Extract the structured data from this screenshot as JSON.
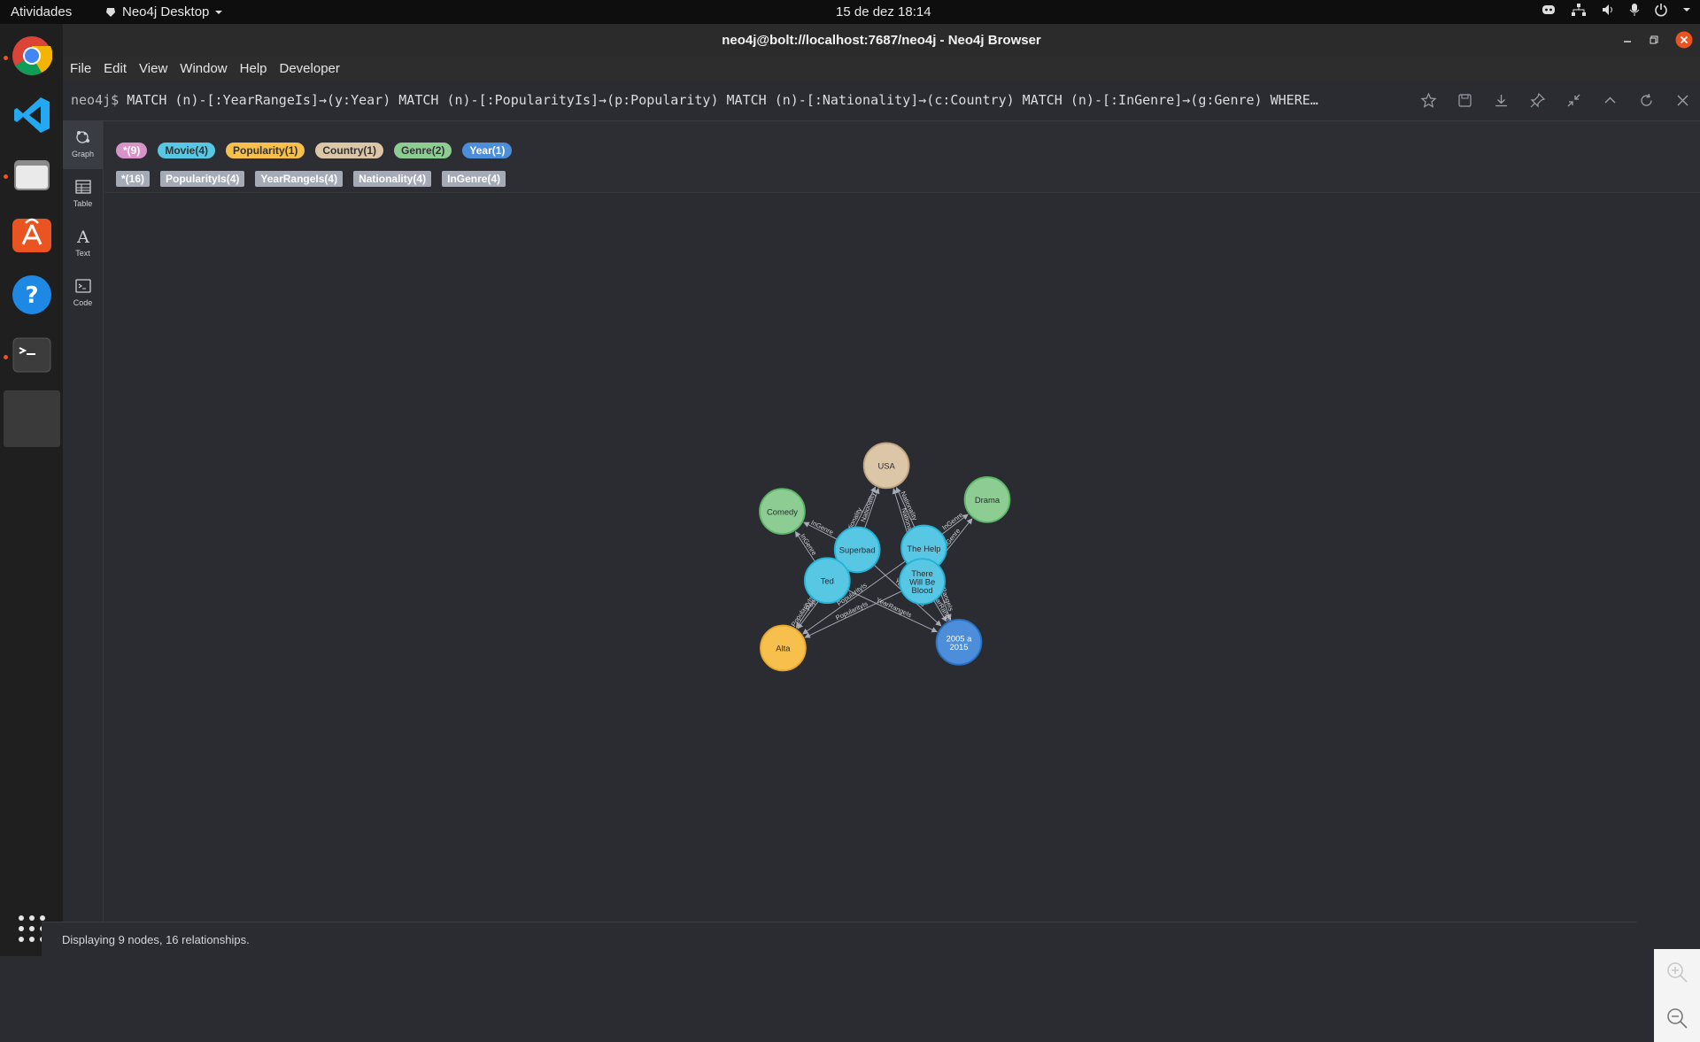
{
  "topbar": {
    "activities": "Atividades",
    "app_name": "Neo4j Desktop",
    "clock": "15 de dez  18:14"
  },
  "window": {
    "title": "neo4j@bolt://localhost:7687/neo4j - Neo4j Browser"
  },
  "menu": [
    "File",
    "Edit",
    "View",
    "Window",
    "Help",
    "Developer"
  ],
  "query": {
    "prompt": "neo4j$",
    "text": "MATCH (n)-[:YearRangeIs]→(y:Year) MATCH (n)-[:PopularityIs]→(p:Popularity) MATCH (n)-[:Nationality]→(c:Country) MATCH (n)-[:InGenre]→(g:Genre) WHERE…"
  },
  "rail": [
    {
      "label": "Graph",
      "icon": "graph-icon"
    },
    {
      "label": "Table",
      "icon": "table-icon"
    },
    {
      "label": "Text",
      "icon": "text-icon"
    },
    {
      "label": "Code",
      "icon": "code-icon"
    }
  ],
  "node_labels": [
    {
      "text": "*(9)",
      "color": "#d893c9"
    },
    {
      "text": "Movie(4)",
      "color": "#57c7e3"
    },
    {
      "text": "Popularity(1)",
      "color": "#f7c04c"
    },
    {
      "text": "Country(1)",
      "color": "#dcc6a8"
    },
    {
      "text": "Genre(2)",
      "color": "#8dcc93"
    },
    {
      "text": "Year(1)",
      "color": "#4c8eda"
    }
  ],
  "rel_types": [
    "*(16)",
    "PopularityIs(4)",
    "YearRangeIs(4)",
    "Nationality(4)",
    "InGenre(4)"
  ],
  "graph": {
    "nodes": [
      {
        "id": "usa",
        "label": "USA",
        "color": "#dcc6a8",
        "border": "#c0a47f"
      },
      {
        "id": "comedy",
        "label": "Comedy",
        "color": "#8dcc93",
        "border": "#5db665"
      },
      {
        "id": "drama",
        "label": "Drama",
        "color": "#8dcc93",
        "border": "#5db665"
      },
      {
        "id": "superbad",
        "label": "Superbad",
        "color": "#57c7e3",
        "border": "#23b3d7"
      },
      {
        "id": "thehelp",
        "label": "The Help",
        "color": "#57c7e3",
        "border": "#23b3d7"
      },
      {
        "id": "ted",
        "label": "Ted",
        "color": "#57c7e3",
        "border": "#23b3d7"
      },
      {
        "id": "twbb",
        "label": "There Will Be Blood",
        "color": "#57c7e3",
        "border": "#23b3d7"
      },
      {
        "id": "alta",
        "label": "Alta",
        "color": "#f7c04c",
        "border": "#e7a82e"
      },
      {
        "id": "year",
        "label": "2005 a 2015",
        "color": "#4c8eda",
        "border": "#2870c2"
      }
    ],
    "relationships": [
      {
        "from": "superbad",
        "to": "usa",
        "type": "Nationality"
      },
      {
        "from": "ted",
        "to": "usa",
        "type": "Nationality"
      },
      {
        "from": "thehelp",
        "to": "usa",
        "type": "Nationality"
      },
      {
        "from": "twbb",
        "to": "usa",
        "type": "Nationality"
      },
      {
        "from": "superbad",
        "to": "comedy",
        "type": "InGenre"
      },
      {
        "from": "ted",
        "to": "comedy",
        "type": "InGenre"
      },
      {
        "from": "thehelp",
        "to": "drama",
        "type": "InGenre"
      },
      {
        "from": "twbb",
        "to": "drama",
        "type": "InGenre"
      },
      {
        "from": "superbad",
        "to": "alta",
        "type": "PopularityIs"
      },
      {
        "from": "ted",
        "to": "alta",
        "type": "PopularityIs"
      },
      {
        "from": "thehelp",
        "to": "alta",
        "type": "PopularityIs"
      },
      {
        "from": "twbb",
        "to": "alta",
        "type": "PopularityIs"
      },
      {
        "from": "superbad",
        "to": "year",
        "type": "YearRangeIs"
      },
      {
        "from": "ted",
        "to": "year",
        "type": "YearRangeIs"
      },
      {
        "from": "thehelp",
        "to": "year",
        "type": "YearRangeIs"
      },
      {
        "from": "twbb",
        "to": "year",
        "type": "YearRangeIs"
      }
    ]
  },
  "status": "Displaying 9 nodes, 16 relationships."
}
